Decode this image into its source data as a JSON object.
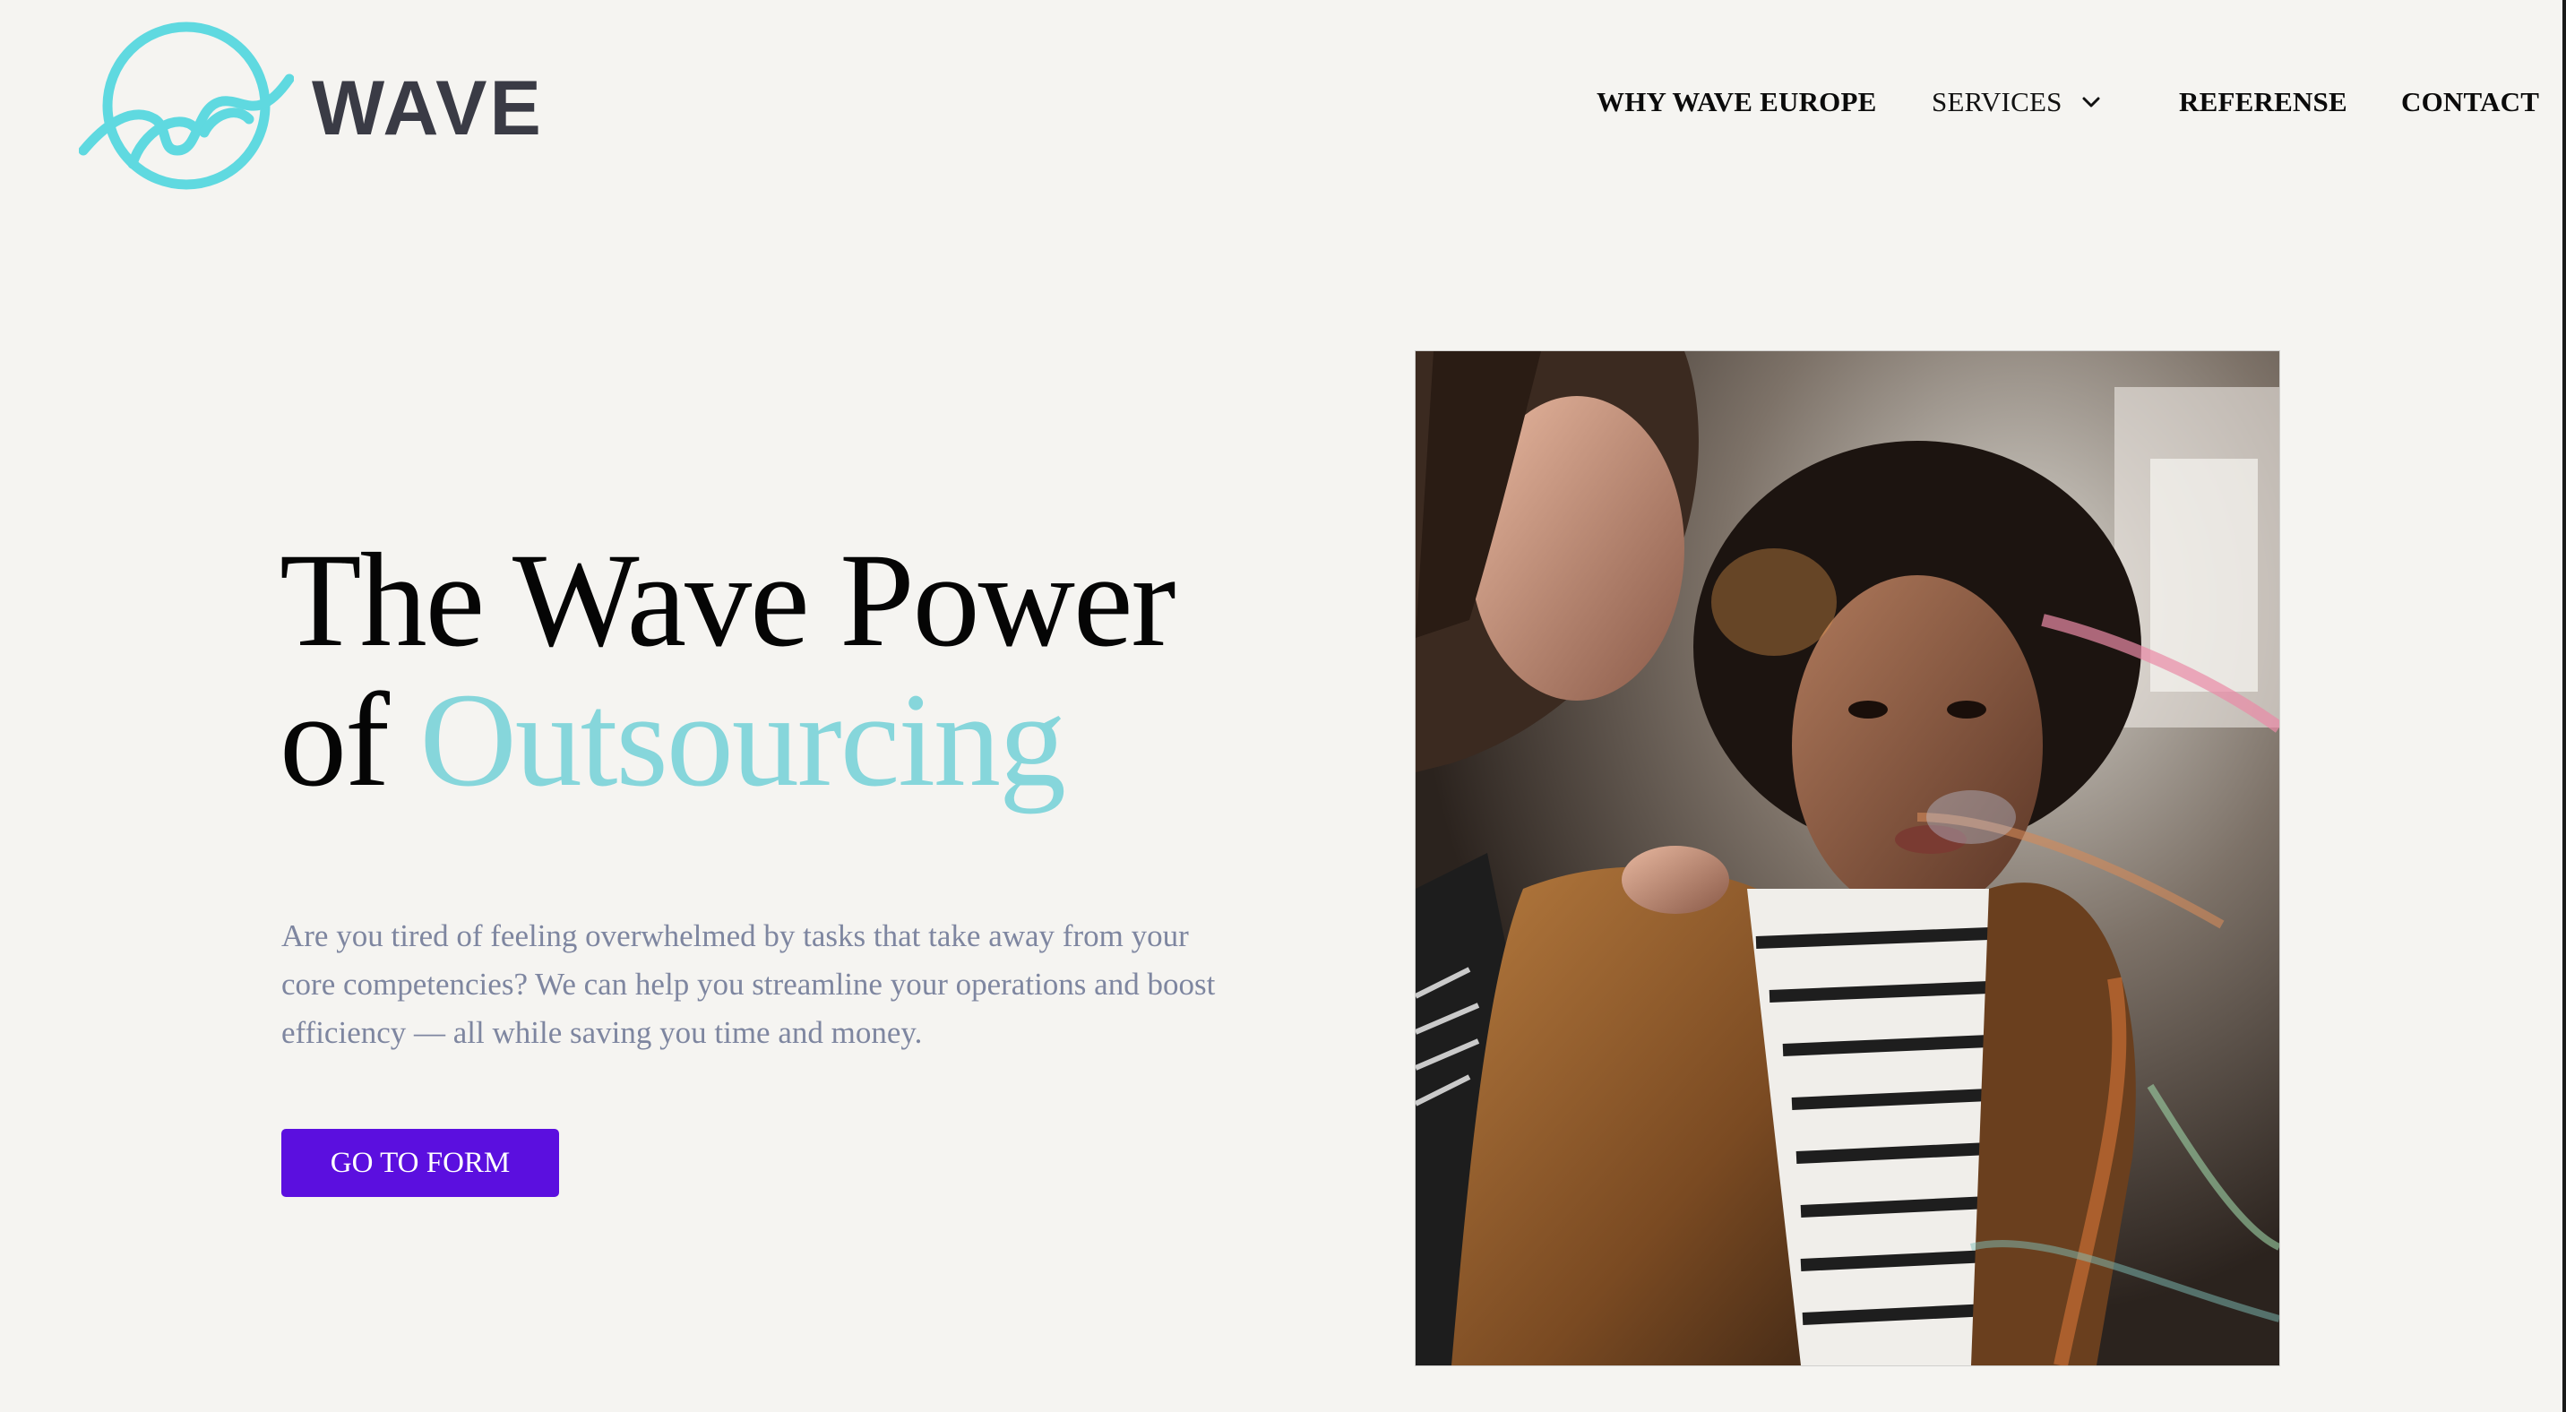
{
  "brand": {
    "name": "WAVE",
    "accent_color": "#86d6db",
    "text_color": "#3a3b45"
  },
  "nav": {
    "items": [
      {
        "label": "WHY WAVE EUROPE"
      },
      {
        "label": "SERVICES",
        "has_dropdown": true,
        "icon": "chevron-down-icon"
      },
      {
        "label": "REFERENSE"
      },
      {
        "label": "CONTACT"
      }
    ]
  },
  "hero": {
    "title_line1": "The Wave Power",
    "title_line2_prefix": "of ",
    "title_line2_accent": "Outsourcing",
    "description": "Are you tired of feeling overwhelmed by tasks that take away from your core competencies? We can help you streamline your operations and boost efficiency — all while saving you time and money.",
    "cta_label": "GO TO FORM",
    "cta_color": "#5b0fdf",
    "image_icon": "hero-photo"
  }
}
